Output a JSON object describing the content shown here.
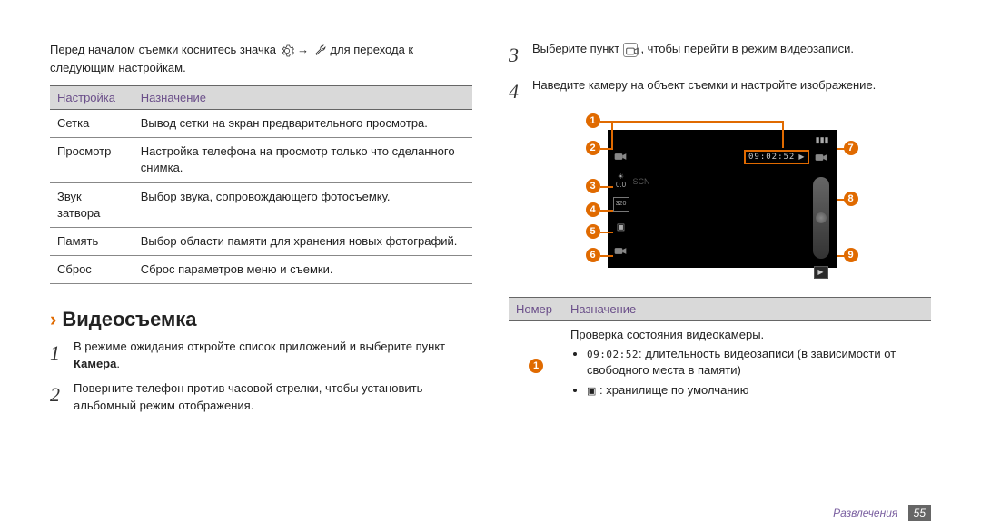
{
  "intro": {
    "before": "Перед началом съемки коснитесь значка ",
    "arrow": " → ",
    "after": " для перехода к следующим настройкам."
  },
  "settings": {
    "header_setting": "Настройка",
    "header_purpose": "Назначение",
    "rows": [
      {
        "name": "Сетка",
        "desc": "Вывод сетки на экран предварительного просмотра."
      },
      {
        "name": "Просмотр",
        "desc": "Настройка телефона на просмотр только что сделанного снимка."
      },
      {
        "name": "Звук затвора",
        "desc": "Выбор звука, сопровождающего фотосъемку."
      },
      {
        "name": "Память",
        "desc": "Выбор области памяти для хранения новых фотографий."
      },
      {
        "name": "Сброс",
        "desc": "Сброс параметров меню и съемки."
      }
    ]
  },
  "heading": "Видеосъемка",
  "steps_left": [
    {
      "num": "1",
      "text_a": "В режиме ожидания откройте список приложений и выберите пункт ",
      "bold": "Камера",
      "text_b": "."
    },
    {
      "num": "2",
      "text_a": "Поверните телефон против часовой стрелки, чтобы установить альбомный режим отображения.",
      "bold": "",
      "text_b": ""
    }
  ],
  "steps_right": [
    {
      "num": "3",
      "text_a": "Выберите пункт ",
      "icon": "camcorder",
      "text_b": " , чтобы перейти в режим видеозаписи."
    },
    {
      "num": "4",
      "text_a": "Наведите камеру на объект съемки и настройте изображение.",
      "icon": "",
      "text_b": ""
    }
  ],
  "diagram": {
    "rec_time": "09:02:52",
    "callouts": [
      "1",
      "2",
      "3",
      "4",
      "5",
      "6",
      "7",
      "8",
      "9"
    ]
  },
  "legend": {
    "header_num": "Номер",
    "header_purpose": "Назначение",
    "row1": {
      "callout": "1",
      "title": "Проверка состояния видеокамеры.",
      "item1_time": "09:02:52",
      "item1_text": ": длительность видеозаписи (в зависимости от свободного места в памяти)",
      "item2_text": " : хранилище по умолчанию"
    }
  },
  "footer": {
    "section": "Развлечения",
    "page": "55"
  }
}
